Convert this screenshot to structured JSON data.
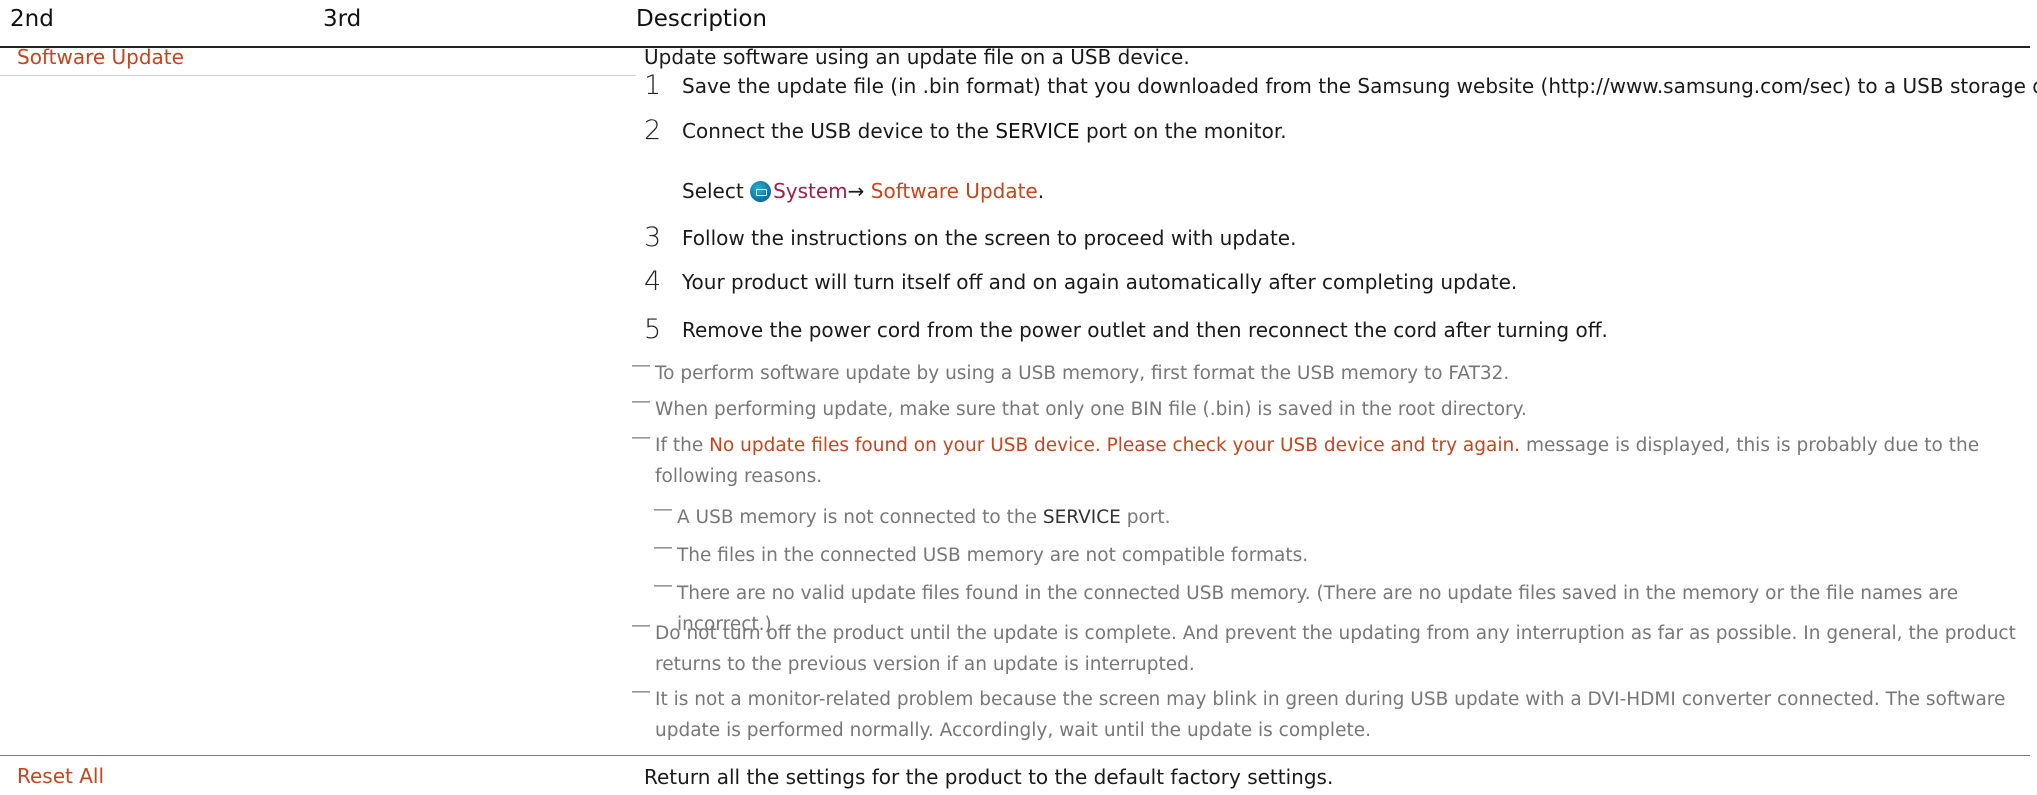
{
  "header": {
    "col1": "2nd",
    "col2": "3rd",
    "col3": "Description"
  },
  "software_update": {
    "label": "Software Update",
    "intro": "Update software using an update file on a USB device.",
    "steps": [
      {
        "num": "1",
        "text": "Save the update file (in .bin format) that you downloaded from the Samsung website (http://www.samsung.com/sec) to a USB storage device."
      },
      {
        "num": "2",
        "pre": "Connect the USB device to the ",
        "strong": "SERVICE",
        "post": " port on the monitor."
      },
      {
        "num": "3",
        "text": "Follow the instructions on the screen to proceed with update."
      },
      {
        "num": "4",
        "text": "Your product will turn itself off and on again automatically after completing update."
      },
      {
        "num": "5",
        "text": "Remove the power cord from the power outlet and then reconnect the cord after turning off."
      }
    ],
    "select_line": {
      "pre": "Select ",
      "system": "System",
      "arrow": "→ ",
      "target": "Software Update",
      "post": "."
    },
    "notes": [
      {
        "text": "To perform software update by using a USB memory, first format the USB memory to FAT32."
      },
      {
        "text": "When performing update, make sure that only one BIN file (.bin) is saved in the root directory."
      },
      {
        "pre": "If the ",
        "highlight": "No update files found on your USB device. Please check your USB device and try again.",
        "post": " message is displayed, this is probably due to the following reasons."
      },
      {
        "pre": "A USB memory is not connected to the ",
        "strong": "SERVICE",
        "post": " port."
      },
      {
        "text": "The files in the connected USB memory are not compatible formats."
      },
      {
        "text": "There are no valid update files found in the connected USB memory. (There are no update files saved in the memory or the file names are incorrect.)"
      },
      {
        "text": "Do not turn off the product until the update is complete. And prevent the updating from any interruption as far as possible. In general, the product returns to the previous version if an update is interrupted."
      },
      {
        "text": "It is not a monitor-related problem because the screen may blink in green during USB update with a DVI-HDMI converter connected. The software update is performed normally. Accordingly, wait until the update is complete."
      }
    ],
    "note_dash": "―"
  },
  "reset_all": {
    "label": "Reset All",
    "description": "Return all the settings for the product to the default factory settings."
  },
  "colors": {
    "menu_red": "#c8441c",
    "system_link": "#9c1f49",
    "note_gray": "#777777",
    "rule": "#222222"
  },
  "icons": {
    "system": "system-settings-icon"
  }
}
